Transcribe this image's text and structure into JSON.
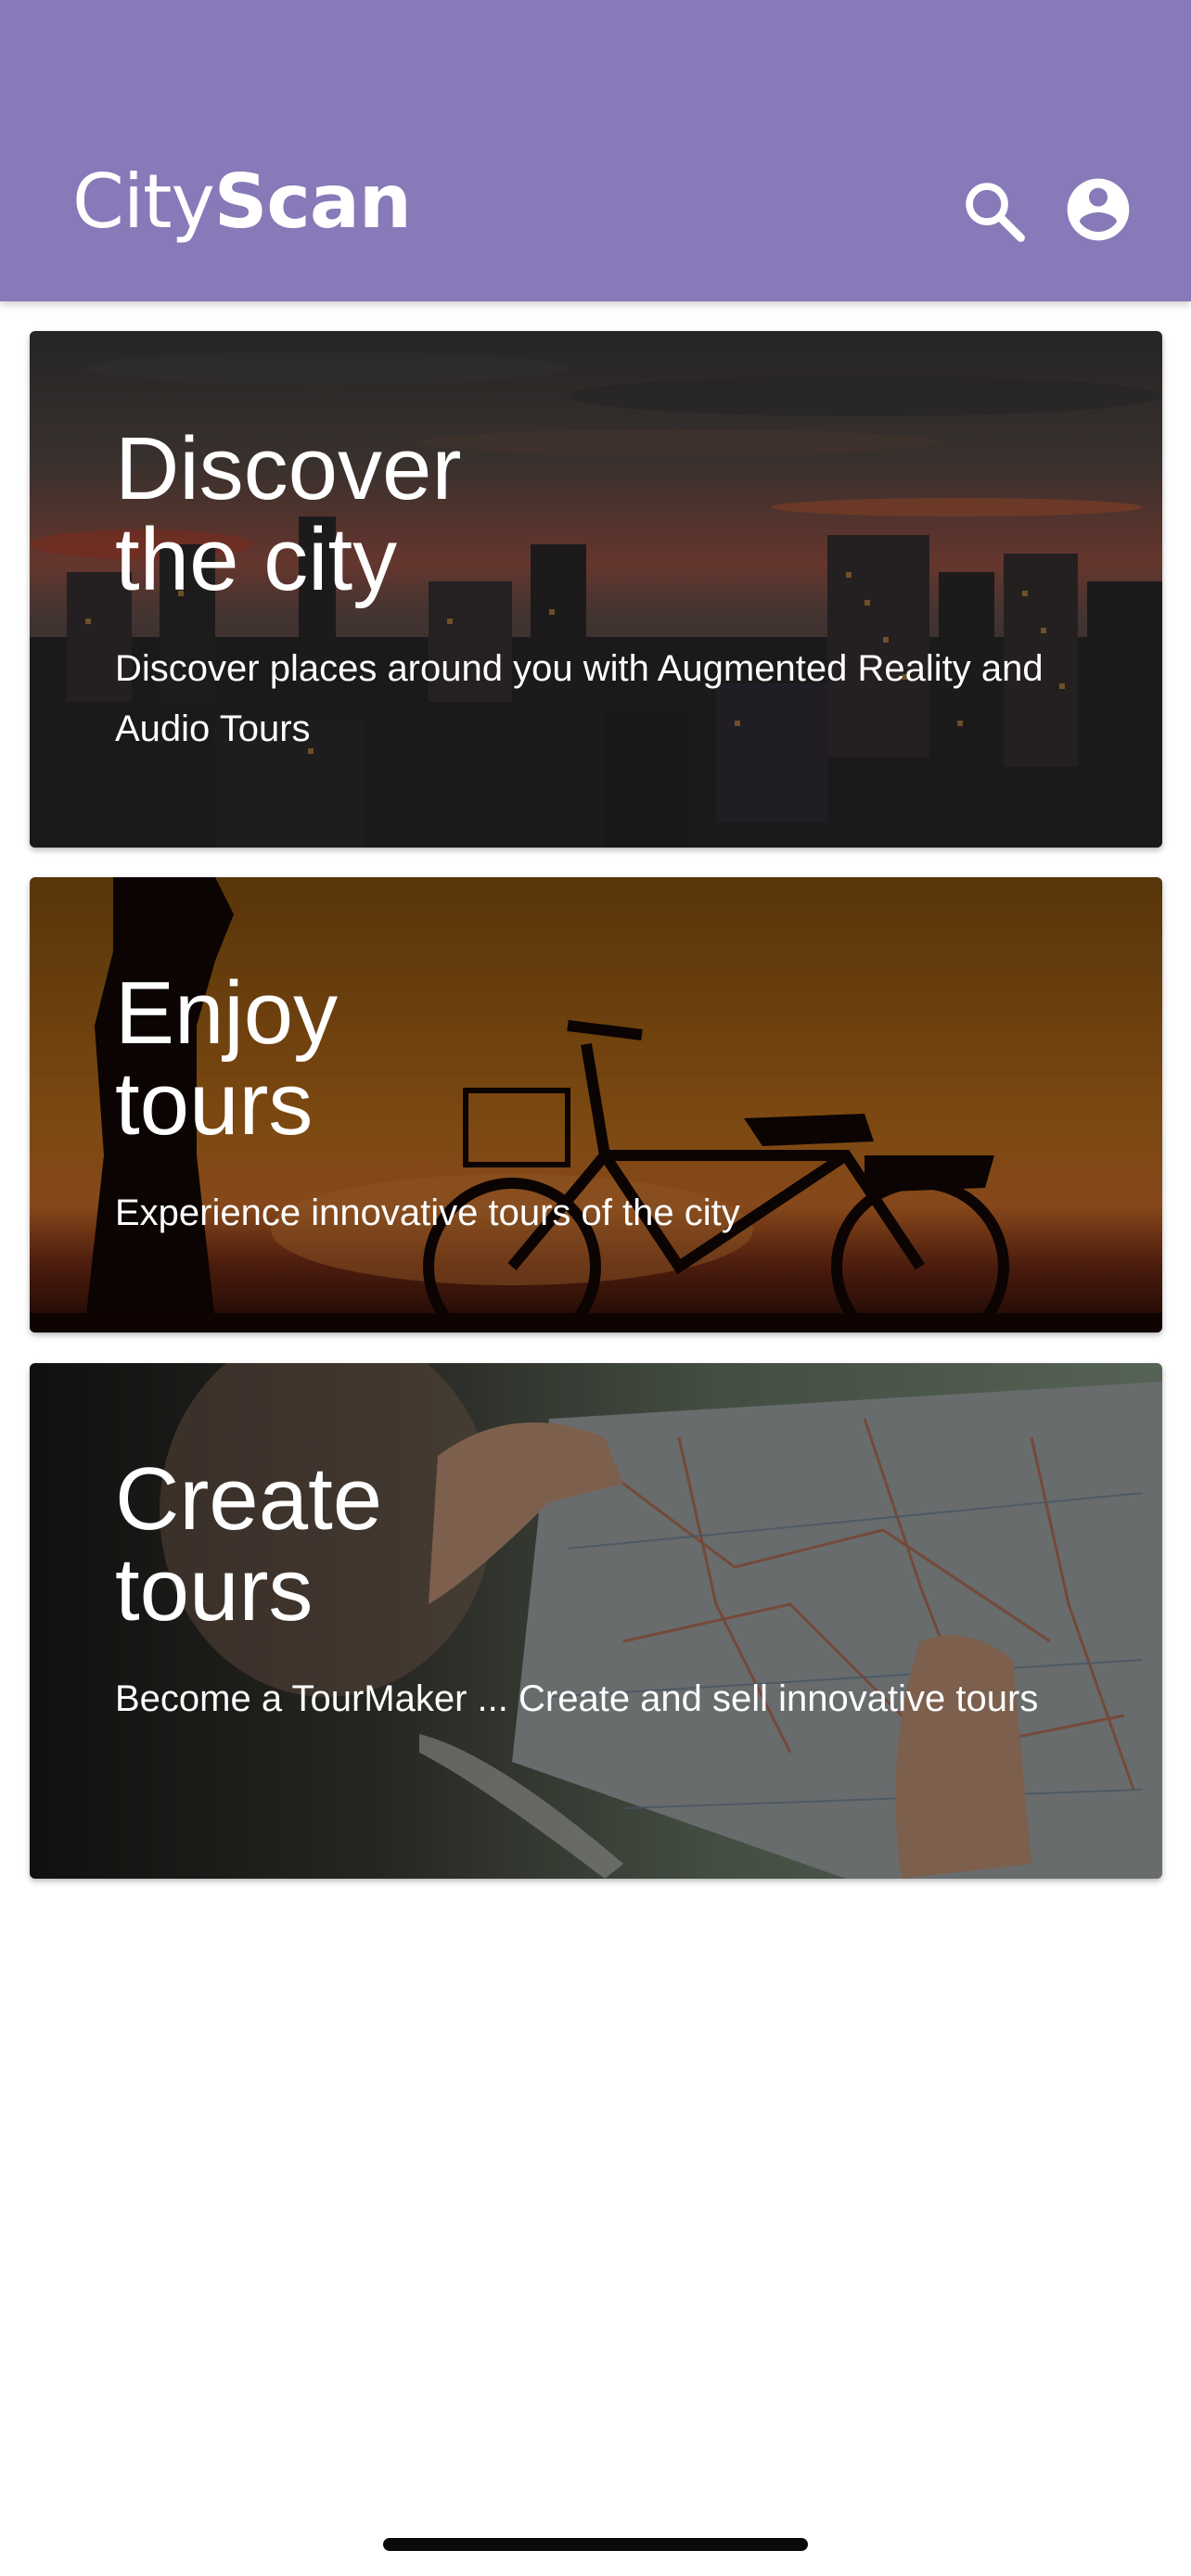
{
  "app": {
    "logo_light": "City",
    "logo_bold": "Scan",
    "brand_color": "#8879b8"
  },
  "header": {
    "search_icon": "search-icon",
    "account_icon": "account-circle-icon"
  },
  "cards": [
    {
      "title_line1": "Discover",
      "title_line2": "the city",
      "description": "Discover places around you with Augmented Reality and Audio Tours",
      "image": "city-skyline-sunset"
    },
    {
      "title_line1": "Enjoy",
      "title_line2": "tours",
      "description": "Experience innovative tours of the city",
      "image": "bicycle-sunset-silhouette"
    },
    {
      "title_line1": "Create",
      "title_line2": "tours",
      "description": "Become a TourMaker ... Create and sell innovative tours",
      "image": "hands-holding-map"
    }
  ]
}
